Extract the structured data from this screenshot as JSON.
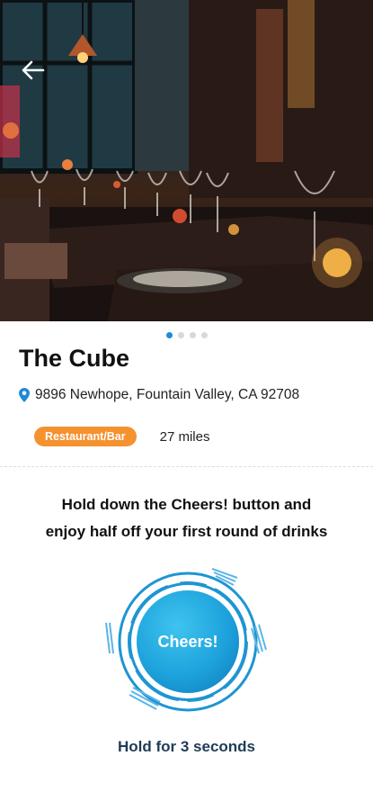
{
  "venue": {
    "name": "The Cube",
    "address": "9896 Newhope, Fountain Valley, CA 92708",
    "category": "Restaurant/Bar",
    "distance": "27 miles"
  },
  "carousel": {
    "total": 4,
    "active_index": 0
  },
  "promo": {
    "line1": "Hold down the Cheers! button and",
    "line2": "enjoy half off your first round of drinks"
  },
  "cheers": {
    "button_label": "Cheers!",
    "hold_instruction": "Hold for 3 seconds"
  },
  "icons": {
    "back": "arrow-left-icon",
    "location": "map-pin-icon"
  },
  "colors": {
    "accent_blue": "#1f8bd6",
    "badge_orange": "#f4922f",
    "hold_text": "#1f3b57"
  }
}
